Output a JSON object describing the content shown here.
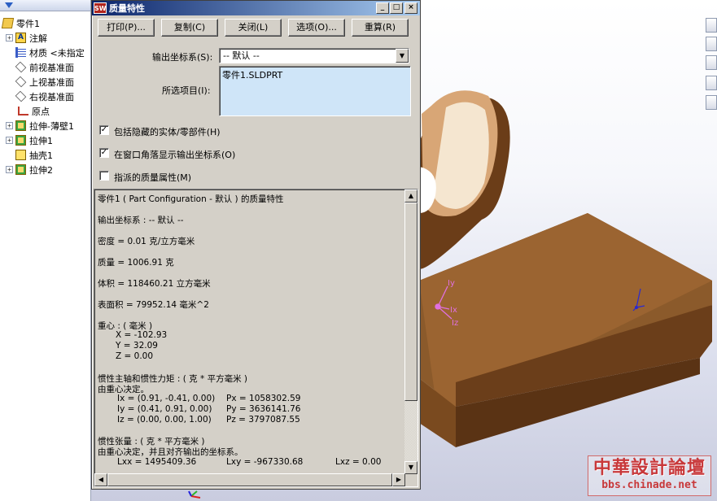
{
  "tree": {
    "filter_icon": "funnel-icon",
    "items": [
      {
        "label": "零件1",
        "icon": "part-icon",
        "expand": ""
      },
      {
        "label": "注解",
        "icon": "annotation-icon",
        "expand": "+"
      },
      {
        "label": "材质 <未指定",
        "icon": "material-icon",
        "expand": ""
      },
      {
        "label": "前视基准面",
        "icon": "plane-icon",
        "expand": ""
      },
      {
        "label": "上视基准面",
        "icon": "plane-icon",
        "expand": ""
      },
      {
        "label": "右视基准面",
        "icon": "plane-icon",
        "expand": ""
      },
      {
        "label": "原点",
        "icon": "origin-icon",
        "expand": ""
      },
      {
        "label": "拉伸-薄壁1",
        "icon": "extrude-icon",
        "expand": "+"
      },
      {
        "label": "拉伸1",
        "icon": "extrude-icon",
        "expand": "+"
      },
      {
        "label": "抽壳1",
        "icon": "shell-icon",
        "expand": ""
      },
      {
        "label": "拉伸2",
        "icon": "extrude-icon",
        "expand": "+"
      }
    ]
  },
  "dialog": {
    "app_icon_text": "SW",
    "title": "质量特性",
    "title_buttons": [
      "_",
      "□",
      "×"
    ],
    "buttons": {
      "print": "打印(P)...",
      "copy": "复制(C)",
      "close": "关闭(L)",
      "options": "选项(O)...",
      "recalc": "重算(R)"
    },
    "coord_label": "输出坐标系(S):",
    "coord_value": "-- 默认 --",
    "selected_label": "所选项目(I):",
    "selected_items": [
      "零件1.SLDPRT"
    ],
    "checkboxes": [
      {
        "label": "包括隐藏的实体/零部件(H)",
        "checked": true
      },
      {
        "label": "在窗口角落显示输出坐标系(O)",
        "checked": true
      },
      {
        "label": "指派的质量属性(M)",
        "checked": false
      }
    ],
    "results": {
      "header": "零件1 ( Part Configuration - 默认 ) 的质量特性",
      "coord": "输出坐标系 : -- 默认 --",
      "density": "密度 = 0.01 克/立方毫米",
      "mass": "质量 = 1006.91 克",
      "volume": "体积 = 118460.21 立方毫米",
      "area": "表面积 = 79952.14 毫米^2",
      "cog_title": "重心 : ( 毫米 )",
      "cog_x": "X = -102.93",
      "cog_y": "Y = 32.09",
      "cog_z": "Z = 0.00",
      "principal_title": "惯性主轴和惯性力矩 : ( 克 * 平方毫米 )",
      "principal_from": "由重心决定。",
      "ix": "Ix = (0.91, -0.41, 0.00)",
      "px": "Px = 1058302.59",
      "iy": "Iy = (0.41, 0.91, 0.00)",
      "py": "Py = 3636141.76",
      "iz": "Iz = (0.00, 0.00, 1.00)",
      "pz": "Pz = 3797087.55",
      "tensor_title": "惯性张量 : ( 克 * 平方毫米 )",
      "tensor_from": "由重心决定，并且对齐输出的坐标系。",
      "lxx": "Lxx = 1495409.36",
      "lxy": "Lxy = -967330.68",
      "lxz": "Lxz = 0.00"
    }
  },
  "viewport": {
    "model_color": "#8b5a2b",
    "triad_color": "#e070e0",
    "triad_labels": {
      "y": "Iy",
      "x": "Ix",
      "z": "Iz"
    },
    "axis_color": "#2a2ad0"
  },
  "right_toolbar": [
    "home-icon",
    "view-icon",
    "folder-icon",
    "list-icon",
    "bulb-icon"
  ],
  "watermark": {
    "big": "中華設計論壇",
    "small": "bbs.chinade.net"
  }
}
